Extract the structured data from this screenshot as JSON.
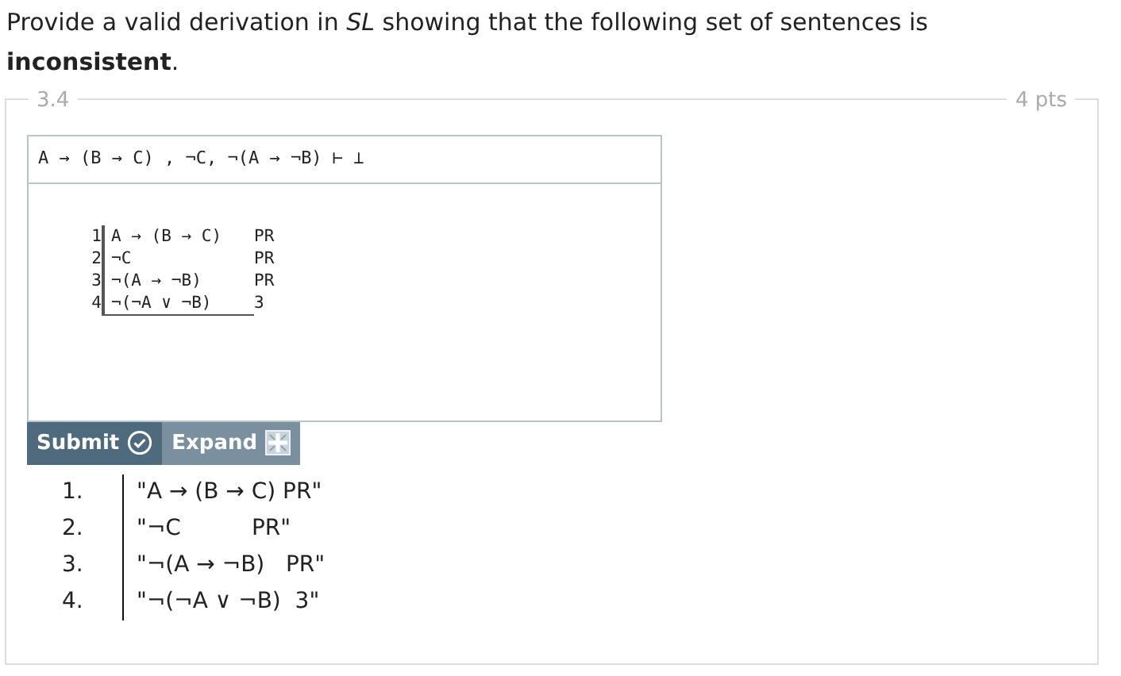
{
  "question": "Provide a valid derivation in *SL* showing that the following set of sentences is **inconsistent**.",
  "problem": {
    "number": "3.4",
    "points": "4 pts"
  },
  "argument": "A → (B → C) , ¬C, ¬(A → ¬B) ⊢ ⊥",
  "proof_lines": [
    {
      "number": "1",
      "formula": "A → (B → C)",
      "justification": "PR",
      "underlined": false
    },
    {
      "number": "2",
      "formula": "¬C",
      "justification": "PR",
      "underlined": false
    },
    {
      "number": "3",
      "formula": "¬(A → ¬B)",
      "justification": "PR",
      "underlined": false
    },
    {
      "number": "4",
      "formula": "¬(¬A ∨ ¬B)",
      "justification": "3",
      "underlined": true
    }
  ],
  "buttons": [
    {
      "kind": "submit",
      "label": "Submit"
    },
    {
      "kind": "expand",
      "label": "Expand"
    }
  ],
  "output": [
    {
      "number": "1.",
      "text": "\"A → (B → C) PR\""
    },
    {
      "number": "2.",
      "text": "\"¬C          PR\""
    },
    {
      "number": "3.",
      "text": "\"¬(A → ¬B)   PR\""
    },
    {
      "number": "4.",
      "text": "\"¬(¬A ∨ ¬B)  3\""
    }
  ]
}
